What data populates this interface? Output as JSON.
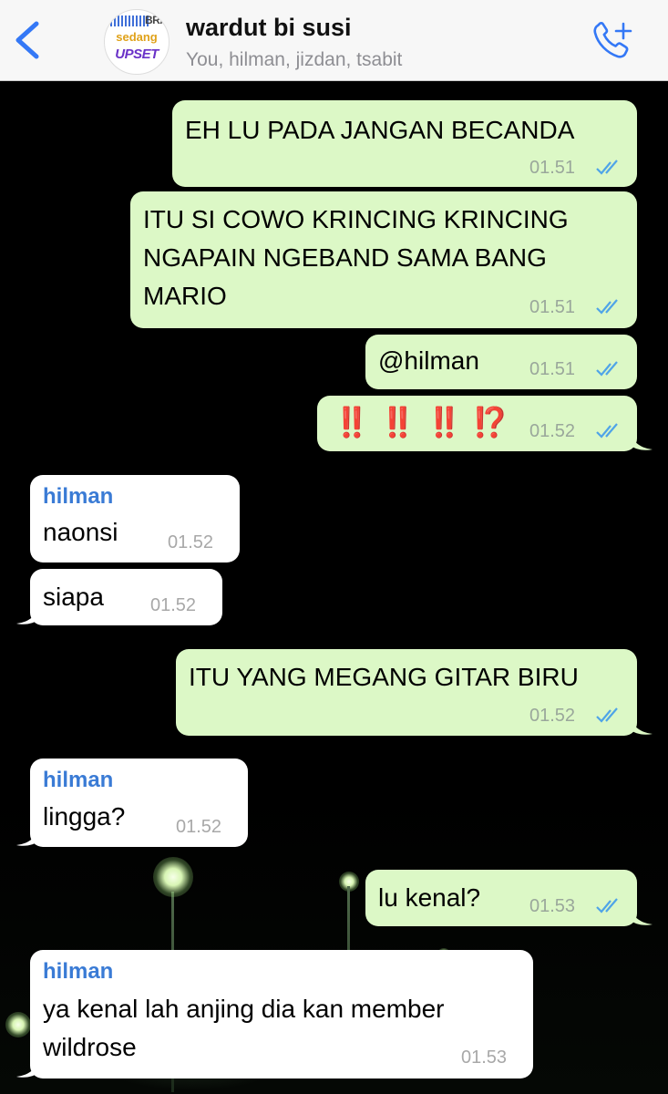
{
  "header": {
    "back_icon": "chevron-left-icon",
    "avatar": {
      "brand_top": "BRA",
      "brand_mid": "sedang",
      "brand_bot": "UPSET"
    },
    "title": "wardut bi susi",
    "subtitle": "You, hilman, jizdan, tsabit",
    "call_icon": "phone-plus-icon",
    "accent": "#3478f6"
  },
  "colors": {
    "outgoing_bubble": "#dcf8c6",
    "incoming_bubble": "#ffffff",
    "sender_name": "#3a7bd5",
    "read_ticks": "#4fa4e8",
    "emphasis": "#d9291c"
  },
  "messages": [
    {
      "dir": "out",
      "lines": [
        "EH LU PADA JANGAN BECANDA"
      ],
      "time": "01.51",
      "status": "read"
    },
    {
      "dir": "out",
      "lines": [
        "ITU SI COWO KRINCING KRINCING",
        "NGAPAIN NGEBAND SAMA BANG",
        "MARIO"
      ],
      "time": "01.51",
      "status": "read"
    },
    {
      "dir": "out",
      "lines": [
        "@hilman"
      ],
      "time": "01.51",
      "status": "read"
    },
    {
      "dir": "out",
      "lines": [
        "‼️ ‼️ ‼️ ⁉️"
      ],
      "time": "01.52",
      "status": "read"
    },
    {
      "dir": "in",
      "sender": "hilman",
      "lines": [
        "naonsi"
      ],
      "time": "01.52"
    },
    {
      "dir": "in",
      "lines": [
        "siapa"
      ],
      "time": "01.52"
    },
    {
      "dir": "out",
      "lines": [
        "ITU YANG MEGANG GITAR BIRU"
      ],
      "time": "01.52",
      "status": "read"
    },
    {
      "dir": "in",
      "sender": "hilman",
      "lines": [
        "lingga?"
      ],
      "time": "01.52"
    },
    {
      "dir": "out",
      "lines": [
        "lu kenal?"
      ],
      "time": "01.53",
      "status": "read"
    },
    {
      "dir": "in",
      "sender": "hilman",
      "lines": [
        "ya kenal lah anjing dia kan member",
        "wildrose"
      ],
      "time": "01.53"
    }
  ]
}
